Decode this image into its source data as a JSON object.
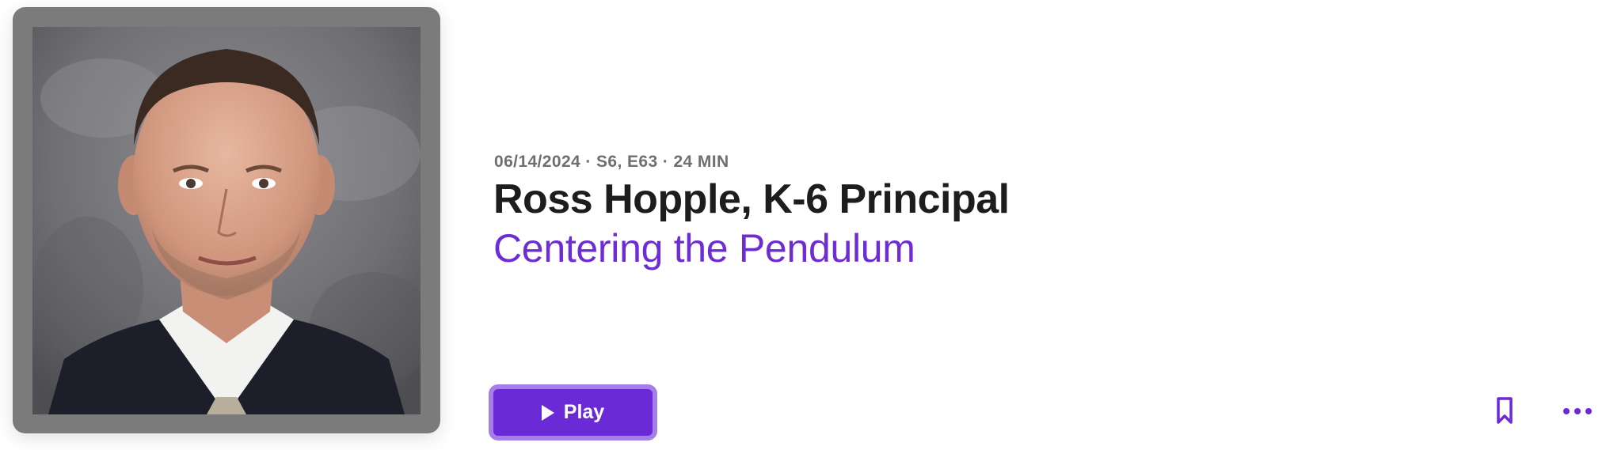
{
  "episode": {
    "date": "06/14/2024",
    "separator": "·",
    "season_episode": "S6, E63",
    "duration": "24 MIN",
    "title": "Ross Hopple, K-6 Principal",
    "show_name": "Centering the Pendulum"
  },
  "artwork": {
    "description_icon": "portrait-photo"
  },
  "actions": {
    "play_label": "Play",
    "play_icon": "play-icon",
    "bookmark_icon": "bookmark-icon",
    "more_icon": "more-icon"
  },
  "colors": {
    "accent": "#6a2ad6",
    "accent_border": "#a57ee8",
    "title": "#1d1d1f",
    "meta": "#6e6e73",
    "artwork_frame": "#7b7b7b"
  }
}
